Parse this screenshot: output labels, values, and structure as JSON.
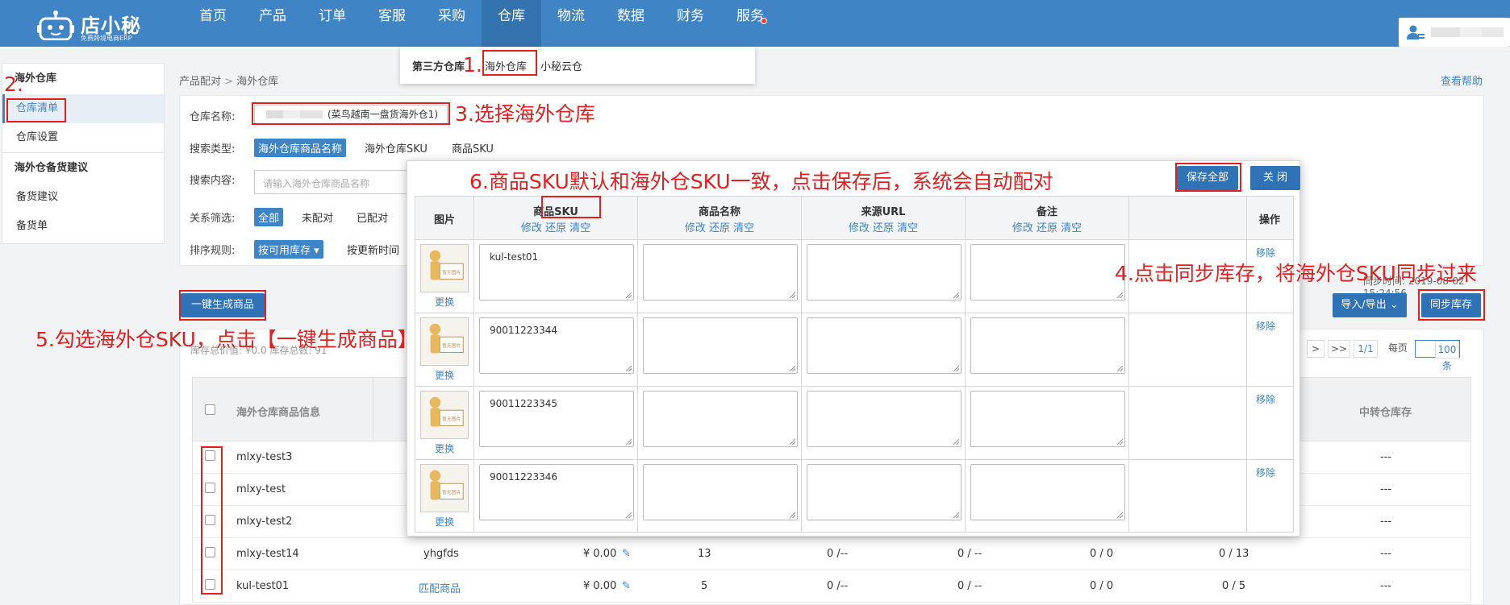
{
  "app": {
    "name": "店小秘",
    "slogan": "免费跨境电商ERP"
  },
  "nav": {
    "items": [
      "首页",
      "产品",
      "订单",
      "客服",
      "采购",
      "仓库",
      "物流",
      "数据",
      "财务",
      "服务"
    ],
    "active": "仓库"
  },
  "dropdown": {
    "label": "第三方仓库",
    "items": [
      "海外仓库",
      "小秘云仓"
    ]
  },
  "sidebar": {
    "groups": [
      {
        "title": "海外仓库",
        "items": [
          "仓库清单",
          "仓库设置"
        ]
      },
      {
        "title": "海外仓备货建议",
        "items": [
          "备货建议",
          "备货单"
        ]
      }
    ]
  },
  "breadcrumb": {
    "parent": "产品配对",
    "sep": " > ",
    "current": "海外仓库"
  },
  "help": "查看帮助",
  "search": {
    "warehouse_label": "仓库名称:",
    "warehouse_value": "(菜鸟越南一盘货海外仓1)",
    "type_label": "搜索类型:",
    "type_options": [
      "海外仓库商品名称",
      "海外仓库SKU",
      "商品SKU"
    ],
    "content_label": "搜索内容:",
    "content_placeholder": "请输入海外仓库商品名称",
    "relation_label": "关系筛选:",
    "relation_options": [
      "全部",
      "未配对",
      "已配对"
    ],
    "sort_label": "排序规则:",
    "sort_options": [
      "按可用库存",
      "按更新时间"
    ]
  },
  "actions": {
    "generate": "一键生成商品",
    "import_export": "导入/导出",
    "sync": "同步库存",
    "sync_time": "同步时间: 2019-08-02 15:24:56"
  },
  "stock_summary": "库存总价值: ¥0.0 库存总数: 91",
  "pager": {
    "next": ">",
    "last": ">>",
    "page": "1/1",
    "per_label": "每页",
    "per_value": "100条"
  },
  "table": {
    "headers": [
      "海外仓库商品信息",
      "中转仓库存"
    ],
    "rows": [
      {
        "name": "mlxy-test3",
        "sku": "",
        "price": "",
        "c1": "",
        "c2": "",
        "c3": "",
        "c4": "",
        "c5": "",
        "transit": "---"
      },
      {
        "name": "mlxy-test",
        "sku": "",
        "price": "",
        "c1": "",
        "c2": "",
        "c3": "",
        "c4": "",
        "c5": "",
        "transit": "---"
      },
      {
        "name": "mlxy-test2",
        "sku": "",
        "price": "",
        "c1": "",
        "c2": "",
        "c3": "",
        "c4": "",
        "c5": "",
        "transit": "---"
      },
      {
        "name": "mlxy-test14",
        "sku": "yhgfds",
        "price": "¥ 0.00",
        "c1": "13",
        "c2": "0 /--",
        "c3": "0 / --",
        "c4": "0 / 0",
        "c5": "0 / 13",
        "transit": "---"
      },
      {
        "name": "kul-test01",
        "sku": "匹配商品",
        "price": "¥ 0.00",
        "c1": "5",
        "c2": "0 /--",
        "c3": "0 / --",
        "c4": "0 / 0",
        "c5": "0 / 5",
        "transit": "---"
      }
    ]
  },
  "modal": {
    "save_all": "保存全部",
    "close": "关 闭",
    "columns": [
      "图片",
      "商品SKU",
      "商品名称",
      "来源URL",
      "备注",
      "操作"
    ],
    "col_actions": "修改 还原 清空",
    "thumb_text": "暂无图片",
    "replace": "更换",
    "remove": "移除",
    "rows": [
      "kul-test01",
      "90011223344",
      "90011223345",
      "90011223346"
    ]
  },
  "annotations": {
    "a1": "1.",
    "a2": "2.",
    "a3": "3.选择海外仓库",
    "a4": "4.点击同步库存，将海外仓SKU同步过来",
    "a5": "5.勾选海外仓SKU，点击【一键生成商品】",
    "a6": "6.商品SKU默认和海外仓SKU一致，点击保存后，系统会自动配对"
  },
  "colors": {
    "header": "#3f84c5",
    "primary_button": "#2f72b6",
    "annotation": "#e02020"
  }
}
